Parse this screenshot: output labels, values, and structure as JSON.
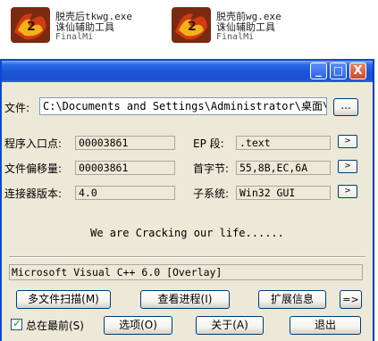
{
  "desktop": {
    "icons": [
      {
        "line1": "脱壳后tkwg.exe",
        "line2": "诛仙辅助工具",
        "line3": "FinalMi",
        "icon": "game-logo-icon"
      },
      {
        "line1": "脱壳前wg.exe",
        "line2": "诛仙辅助工具",
        "line3": "FinalMi",
        "icon": "game-logo-icon"
      }
    ]
  },
  "titlebar": {
    "minimize": "_",
    "maximize": "□",
    "close": "X"
  },
  "file": {
    "label": "文件:",
    "path": "C:\\Documents and Settings\\Administrator\\桌面\\脱",
    "browse_label": "..."
  },
  "fields": {
    "entry_point": {
      "label": "程序入口点:",
      "value": "00003861"
    },
    "file_offset": {
      "label": "文件偏移量:",
      "value": "00003861"
    },
    "linker_version": {
      "label": "连接器版本:",
      "value": "4.0"
    },
    "ep_section": {
      "label": "EP 段:",
      "value": ".text"
    },
    "first_bytes": {
      "label": "首字节:",
      "value": "55,8B,EC,6A"
    },
    "subsystem": {
      "label": "子系统:",
      "value": "Win32 GUI"
    }
  },
  "small_button": ">",
  "message": "We are Cracking our life......",
  "detection": "Microsoft Visual C++ 6.0 [Overlay]",
  "buttons": {
    "multi_scan": "多文件扫描(M)",
    "view_process": "查看进程(I)",
    "extensions": "扩展信息",
    "arrow": "=>",
    "options": "选项(O)",
    "about": "关于(A)",
    "exit": "退出"
  },
  "always_on_top": {
    "label": "总在最前(S)",
    "checked": true
  }
}
